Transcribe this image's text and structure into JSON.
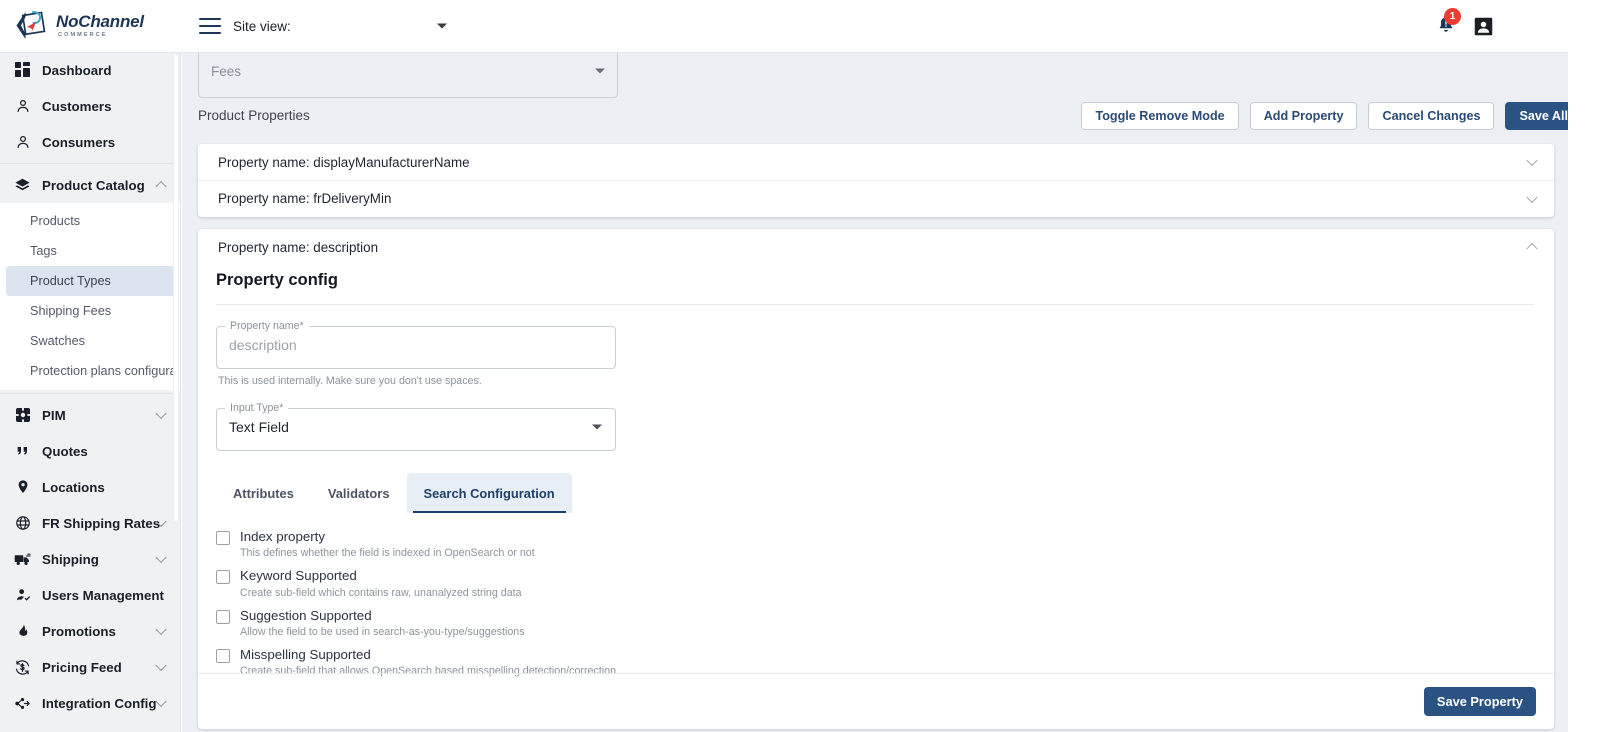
{
  "brand": {
    "name": "NoChannel",
    "sub": "COMMERCE",
    "menu_icon": "hamburger-icon"
  },
  "topbar": {
    "site_view_label": "Site view:",
    "site_view_value": "",
    "notification_count": "1",
    "bell_icon": "bell-icon",
    "account_icon": "account-icon"
  },
  "sidebar": {
    "items": [
      {
        "label": "Dashboard",
        "icon": "dashboard-icon",
        "expandable": false
      },
      {
        "label": "Customers",
        "icon": "person-icon",
        "expandable": false
      },
      {
        "label": "Consumers",
        "icon": "person-icon",
        "expandable": false
      },
      {
        "label": "Product Catalog",
        "icon": "layers-icon",
        "expandable": true,
        "expanded": true
      },
      {
        "label": "PIM",
        "icon": "pim-icon",
        "expandable": true,
        "expanded": false
      },
      {
        "label": "Quotes",
        "icon": "quote-icon",
        "expandable": false
      },
      {
        "label": "Locations",
        "icon": "pin-icon",
        "expandable": false
      },
      {
        "label": "FR Shipping Rates",
        "icon": "globe-icon",
        "expandable": true,
        "expanded": false
      },
      {
        "label": "Shipping",
        "icon": "truck-icon",
        "expandable": true,
        "expanded": false
      },
      {
        "label": "Users Management",
        "icon": "person-check-icon",
        "expandable": false
      },
      {
        "label": "Promotions",
        "icon": "flame-icon",
        "expandable": true,
        "expanded": false
      },
      {
        "label": "Pricing Feed",
        "icon": "price-refresh-icon",
        "expandable": true,
        "expanded": false
      },
      {
        "label": "Integration Config",
        "icon": "integration-icon",
        "expandable": true,
        "expanded": false
      }
    ],
    "product_catalog_children": [
      {
        "label": "Products",
        "active": false
      },
      {
        "label": "Tags",
        "active": false
      },
      {
        "label": "Product Types",
        "active": true
      },
      {
        "label": "Shipping Fees",
        "active": false
      },
      {
        "label": "Swatches",
        "active": false
      },
      {
        "label": "Protection plans configurat",
        "active": false
      }
    ]
  },
  "main": {
    "fees_select_value": "Fees",
    "product_properties_title": "Product Properties",
    "toolbar_buttons": [
      {
        "label": "Toggle Remove Mode",
        "primary": false
      },
      {
        "label": "Add Property",
        "primary": false
      },
      {
        "label": "Cancel Changes",
        "primary": false
      },
      {
        "label": "Save All",
        "primary": true
      }
    ],
    "collapsed_properties": [
      {
        "label": "Property name: displayManufacturerName"
      },
      {
        "label": "Property name: frDeliveryMin"
      }
    ],
    "expanded_property": {
      "header": "Property name: description",
      "section_title": "Property config",
      "property_name_field": {
        "legend": "Property name*",
        "value": "description",
        "helper": "This is used internally. Make sure you don't use spaces."
      },
      "input_type_field": {
        "legend": "Input Type*",
        "value": "Text Field"
      },
      "tabs": [
        {
          "label": "Attributes",
          "active": false
        },
        {
          "label": "Validators",
          "active": false
        },
        {
          "label": "Search Configuration",
          "active": true
        }
      ],
      "search_config_checkboxes": [
        {
          "label": "Index property",
          "help": "This defines whether the field is indexed in OpenSearch or not",
          "checked": false
        },
        {
          "label": "Keyword Supported",
          "help": "Create sub-field which contains raw, unanalyzed string data",
          "checked": false
        },
        {
          "label": "Suggestion Supported",
          "help": "Allow the field to be used in search-as-you-type/suggestions",
          "checked": false
        },
        {
          "label": "Misspelling Supported",
          "help": "Create sub-field that allows OpenSearch based misspelling detection/correction",
          "checked": false
        }
      ],
      "save_button": "Save Property"
    }
  },
  "colors": {
    "primary": "#2a5383",
    "badge": "#ef3b33",
    "main_bg": "#eceff3",
    "sidebar_bg": "#f0f1f3",
    "active_sub": "#dbe4ef"
  }
}
